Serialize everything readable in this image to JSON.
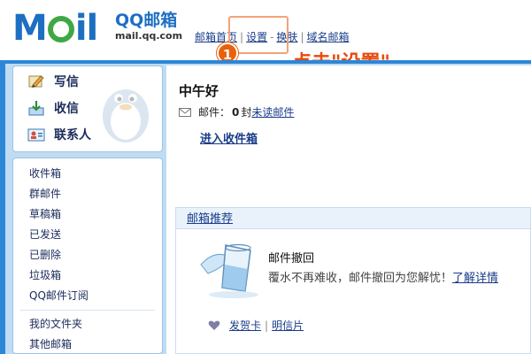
{
  "logo": {
    "word_m": "M",
    "word_il": "il",
    "cn": "QQ邮箱",
    "url": "mail.qq.com"
  },
  "topnav": {
    "home": "邮箱首页",
    "sep1": "|",
    "settings": "设置",
    "sep2": "-",
    "skin": "换肤",
    "sep3": "|",
    "domain": "域名邮箱"
  },
  "tutorial": {
    "step": "1",
    "callout": "点击\"设置\""
  },
  "sidebar": {
    "compose": "写信",
    "receive": "收信",
    "contacts": "联系人",
    "folders": [
      "收件箱",
      "群邮件",
      "草稿箱",
      "已发送",
      "已删除",
      "垃圾箱",
      "QQ邮件订阅"
    ],
    "folders2": [
      "我的文件夹",
      "其他邮箱"
    ]
  },
  "main": {
    "greeting": "中午好",
    "mail_prefix": "邮件：",
    "mail_count": "0",
    "mail_suffix": "封",
    "unread_link": "未读邮件",
    "enter_inbox": "进入收件箱"
  },
  "recommend": {
    "header": "邮箱推荐",
    "title": "邮件撤回",
    "desc": "覆水不再难收，邮件撤回为您解忧！",
    "more": "了解详情",
    "card1": "发贺卡",
    "sep": "|",
    "card2": "明信片"
  },
  "colors": {
    "frame": "#2e86d6",
    "accent": "#e8620c",
    "link": "#1a3d8a"
  }
}
